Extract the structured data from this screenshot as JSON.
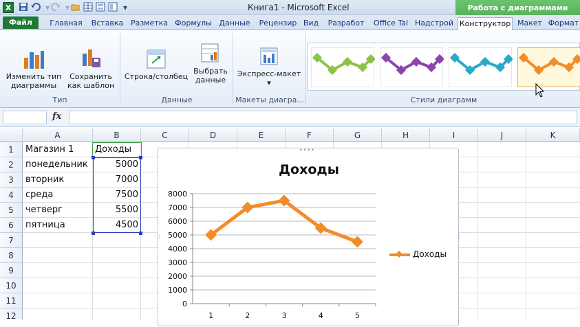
{
  "app": {
    "logo": "X",
    "title": "Книга1 - Microsoft Excel",
    "context_group": "Работа с диаграммами"
  },
  "quick_access": {
    "icons": [
      "save-icon",
      "undo-icon",
      "redo-icon",
      "open-icon",
      "table-icon",
      "sheet-icon",
      "customize-icon"
    ]
  },
  "tabs": [
    {
      "label": "Файл"
    },
    {
      "label": "Главная"
    },
    {
      "label": "Вставка"
    },
    {
      "label": "Разметка"
    },
    {
      "label": "Формулы"
    },
    {
      "label": "Данные"
    },
    {
      "label": "Рецензир"
    },
    {
      "label": "Вид"
    },
    {
      "label": "Разработ"
    },
    {
      "label": "Office Tal"
    },
    {
      "label": "Надстрой"
    },
    {
      "label": "Конструктор"
    },
    {
      "label": "Макет"
    },
    {
      "label": "Формат"
    }
  ],
  "ribbon": {
    "type_group": {
      "change_type_line1": "Изменить тип",
      "change_type_line2": "диаграммы",
      "save_template_line1": "Сохранить",
      "save_template_line2": "как шаблон",
      "label": "Тип"
    },
    "data_group": {
      "switch_row_col": "Строка/столбец",
      "select_data_line1": "Выбрать",
      "select_data_line2": "данные",
      "label": "Данные"
    },
    "layouts_group": {
      "quick_layout": "Экспресс-макет",
      "dropdown": "▾",
      "label": "Макеты диагра..."
    },
    "styles_group": {
      "label": "Стили диаграмм",
      "style_colors": [
        "#8bc34a",
        "#8e44ad",
        "#2aa9c9",
        "#f28c28"
      ]
    }
  },
  "formula_bar": {
    "fx": "fx",
    "name_box": "",
    "value": ""
  },
  "sheet": {
    "columns": [
      "A",
      "B",
      "C",
      "D",
      "E",
      "F",
      "G",
      "H",
      "I",
      "J",
      "K"
    ],
    "rows": [
      "1",
      "2",
      "3",
      "4",
      "5",
      "6",
      "7",
      "8",
      "9",
      "10",
      "11",
      "12"
    ],
    "cells": [
      {
        "a": "Магазин 1",
        "b": "Доходы"
      },
      {
        "a": "понедельник",
        "b": "5000"
      },
      {
        "a": "вторник",
        "b": "7000"
      },
      {
        "a": "среда",
        "b": "7500"
      },
      {
        "a": "четверг",
        "b": "5500"
      },
      {
        "a": "пятница",
        "b": "4500"
      }
    ]
  },
  "chart_data": {
    "type": "line",
    "title": "Доходы",
    "categories": [
      "1",
      "2",
      "3",
      "4",
      "5"
    ],
    "series": [
      {
        "name": "Доходы",
        "values": [
          5000,
          7000,
          7500,
          5500,
          4500
        ],
        "color": "#f28c28"
      }
    ],
    "ylim": [
      0,
      8000
    ],
    "yticks": [
      0,
      1000,
      2000,
      3000,
      4000,
      5000,
      6000,
      7000,
      8000
    ],
    "grid": true,
    "legend": "right"
  }
}
